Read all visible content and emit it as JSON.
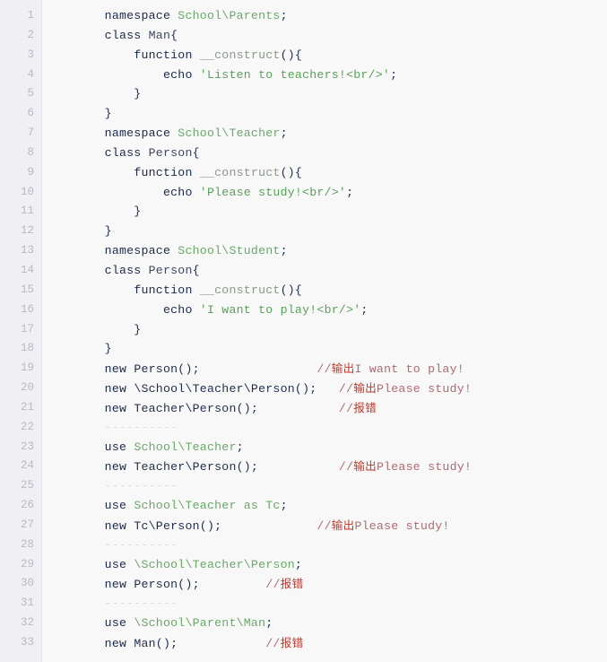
{
  "editor": {
    "language": "php",
    "total_lines": 33,
    "background": "#f8f8f8",
    "gutter_background": "#f0f0f4",
    "gutter_text_color": "#b9b9c4",
    "colors": {
      "keyword": "#1a2a4a",
      "namespace": "#6aa86a",
      "string": "#5aa05a",
      "function": "#8a998a",
      "comment": "#b06a72",
      "comment_cjk": "#c0392b",
      "separator": "#dcdcdc",
      "plain": "#1f2d4d"
    }
  },
  "line_numbers": [
    "1",
    "2",
    "3",
    "4",
    "5",
    "6",
    "7",
    "8",
    "9",
    "10",
    "11",
    "12",
    "13",
    "14",
    "15",
    "16",
    "17",
    "18",
    "19",
    "20",
    "21",
    "22",
    "23",
    "24",
    "25",
    "26",
    "27",
    "28",
    "29",
    "30",
    "31",
    "32",
    "33"
  ],
  "lines": [
    {
      "n": "1",
      "tokens": [
        {
          "t": "    ",
          "c": "plain"
        },
        {
          "t": "namespace ",
          "c": "keyword"
        },
        {
          "t": "School\\Parents",
          "c": "ns"
        },
        {
          "t": ";",
          "c": "punct"
        }
      ]
    },
    {
      "n": "2",
      "tokens": [
        {
          "t": "    ",
          "c": "plain"
        },
        {
          "t": "class ",
          "c": "keyword"
        },
        {
          "t": "Man",
          "c": "class"
        },
        {
          "t": "{",
          "c": "punct"
        }
      ]
    },
    {
      "n": "3",
      "tokens": [
        {
          "t": "        ",
          "c": "plain"
        },
        {
          "t": "function ",
          "c": "keyword"
        },
        {
          "t": "__construct",
          "c": "func"
        },
        {
          "t": "(){",
          "c": "punct"
        }
      ]
    },
    {
      "n": "4",
      "tokens": [
        {
          "t": "            ",
          "c": "plain"
        },
        {
          "t": "echo ",
          "c": "keyword"
        },
        {
          "t": "'Listen to teachers!<br/>'",
          "c": "string"
        },
        {
          "t": ";",
          "c": "punct"
        }
      ]
    },
    {
      "n": "5",
      "tokens": [
        {
          "t": "        }",
          "c": "punct"
        }
      ]
    },
    {
      "n": "6",
      "tokens": [
        {
          "t": "    }",
          "c": "punct"
        }
      ]
    },
    {
      "n": "7",
      "tokens": [
        {
          "t": "    ",
          "c": "plain"
        },
        {
          "t": "namespace ",
          "c": "keyword"
        },
        {
          "t": "School\\Teacher",
          "c": "ns"
        },
        {
          "t": ";",
          "c": "punct"
        }
      ]
    },
    {
      "n": "8",
      "tokens": [
        {
          "t": "    ",
          "c": "plain"
        },
        {
          "t": "class ",
          "c": "keyword"
        },
        {
          "t": "Person",
          "c": "class"
        },
        {
          "t": "{",
          "c": "punct"
        }
      ]
    },
    {
      "n": "9",
      "tokens": [
        {
          "t": "        ",
          "c": "plain"
        },
        {
          "t": "function ",
          "c": "keyword"
        },
        {
          "t": "__construct",
          "c": "func"
        },
        {
          "t": "(){",
          "c": "punct"
        }
      ]
    },
    {
      "n": "10",
      "tokens": [
        {
          "t": "            ",
          "c": "plain"
        },
        {
          "t": "echo ",
          "c": "keyword"
        },
        {
          "t": "'Please study!<br/>'",
          "c": "string"
        },
        {
          "t": ";",
          "c": "punct"
        }
      ]
    },
    {
      "n": "11",
      "tokens": [
        {
          "t": "        }",
          "c": "punct"
        }
      ]
    },
    {
      "n": "12",
      "tokens": [
        {
          "t": "    }",
          "c": "punct"
        }
      ]
    },
    {
      "n": "13",
      "tokens": [
        {
          "t": "    ",
          "c": "plain"
        },
        {
          "t": "namespace ",
          "c": "keyword"
        },
        {
          "t": "School\\Student",
          "c": "ns"
        },
        {
          "t": ";",
          "c": "punct"
        }
      ]
    },
    {
      "n": "14",
      "tokens": [
        {
          "t": "    ",
          "c": "plain"
        },
        {
          "t": "class ",
          "c": "keyword"
        },
        {
          "t": "Person",
          "c": "class"
        },
        {
          "t": "{",
          "c": "punct"
        }
      ]
    },
    {
      "n": "15",
      "tokens": [
        {
          "t": "        ",
          "c": "plain"
        },
        {
          "t": "function ",
          "c": "keyword"
        },
        {
          "t": "__construct",
          "c": "func"
        },
        {
          "t": "(){",
          "c": "punct"
        }
      ]
    },
    {
      "n": "16",
      "tokens": [
        {
          "t": "            ",
          "c": "plain"
        },
        {
          "t": "echo ",
          "c": "keyword"
        },
        {
          "t": "'I want to play!<br/>'",
          "c": "string"
        },
        {
          "t": ";",
          "c": "punct"
        }
      ]
    },
    {
      "n": "17",
      "tokens": [
        {
          "t": "        }",
          "c": "punct"
        }
      ]
    },
    {
      "n": "18",
      "tokens": [
        {
          "t": "    }",
          "c": "punct"
        }
      ]
    },
    {
      "n": "19",
      "tokens": [
        {
          "t": "    ",
          "c": "plain"
        },
        {
          "t": "new ",
          "c": "keyword"
        },
        {
          "t": "Person();",
          "c": "plain"
        },
        {
          "t": "                ",
          "c": "plain"
        },
        {
          "t": "//",
          "c": "comment"
        },
        {
          "t": "输出",
          "c": "cjk"
        },
        {
          "t": "I want to play!",
          "c": "comment"
        }
      ]
    },
    {
      "n": "20",
      "tokens": [
        {
          "t": "    ",
          "c": "plain"
        },
        {
          "t": "new ",
          "c": "keyword"
        },
        {
          "t": "\\School\\Teacher\\Person();",
          "c": "plain"
        },
        {
          "t": "   ",
          "c": "plain"
        },
        {
          "t": "//",
          "c": "comment"
        },
        {
          "t": "输出",
          "c": "cjk"
        },
        {
          "t": "Please study!",
          "c": "comment"
        }
      ]
    },
    {
      "n": "21",
      "tokens": [
        {
          "t": "    ",
          "c": "plain"
        },
        {
          "t": "new ",
          "c": "keyword"
        },
        {
          "t": "Teacher\\Person();",
          "c": "plain"
        },
        {
          "t": "           ",
          "c": "plain"
        },
        {
          "t": "//",
          "c": "comment"
        },
        {
          "t": "报错",
          "c": "cjk"
        }
      ]
    },
    {
      "n": "22",
      "tokens": [
        {
          "t": "    ----------",
          "c": "sep"
        }
      ]
    },
    {
      "n": "23",
      "tokens": [
        {
          "t": "    ",
          "c": "plain"
        },
        {
          "t": "use ",
          "c": "keyword"
        },
        {
          "t": "School\\Teacher",
          "c": "ns"
        },
        {
          "t": ";",
          "c": "punct"
        }
      ]
    },
    {
      "n": "24",
      "tokens": [
        {
          "t": "    ",
          "c": "plain"
        },
        {
          "t": "new ",
          "c": "keyword"
        },
        {
          "t": "Teacher\\Person();",
          "c": "plain"
        },
        {
          "t": "           ",
          "c": "plain"
        },
        {
          "t": "//",
          "c": "comment"
        },
        {
          "t": "输出",
          "c": "cjk"
        },
        {
          "t": "Please study!",
          "c": "comment"
        }
      ]
    },
    {
      "n": "25",
      "tokens": [
        {
          "t": "    ----------",
          "c": "sep"
        }
      ]
    },
    {
      "n": "26",
      "tokens": [
        {
          "t": "    ",
          "c": "plain"
        },
        {
          "t": "use ",
          "c": "keyword"
        },
        {
          "t": "School\\Teacher",
          "c": "ns"
        },
        {
          "t": " as ",
          "c": "ns"
        },
        {
          "t": "Tc",
          "c": "ns"
        },
        {
          "t": ";",
          "c": "punct"
        }
      ]
    },
    {
      "n": "27",
      "tokens": [
        {
          "t": "    ",
          "c": "plain"
        },
        {
          "t": "new ",
          "c": "keyword"
        },
        {
          "t": "Tc\\Person();",
          "c": "plain"
        },
        {
          "t": "             ",
          "c": "plain"
        },
        {
          "t": "//",
          "c": "comment"
        },
        {
          "t": "输出",
          "c": "cjk"
        },
        {
          "t": "Please study!",
          "c": "comment"
        }
      ]
    },
    {
      "n": "28",
      "tokens": [
        {
          "t": "    ----------",
          "c": "sep"
        }
      ]
    },
    {
      "n": "29",
      "tokens": [
        {
          "t": "    ",
          "c": "plain"
        },
        {
          "t": "use ",
          "c": "keyword"
        },
        {
          "t": "\\School\\Teacher\\Person",
          "c": "ns"
        },
        {
          "t": ";",
          "c": "punct"
        }
      ]
    },
    {
      "n": "30",
      "tokens": [
        {
          "t": "    ",
          "c": "plain"
        },
        {
          "t": "new ",
          "c": "keyword"
        },
        {
          "t": "Person();",
          "c": "plain"
        },
        {
          "t": "         ",
          "c": "plain"
        },
        {
          "t": "//",
          "c": "comment"
        },
        {
          "t": "报错",
          "c": "cjk"
        }
      ]
    },
    {
      "n": "31",
      "tokens": [
        {
          "t": "    ----------",
          "c": "sep"
        }
      ]
    },
    {
      "n": "32",
      "tokens": [
        {
          "t": "    ",
          "c": "plain"
        },
        {
          "t": "use ",
          "c": "keyword"
        },
        {
          "t": "\\School\\Parent\\Man",
          "c": "ns"
        },
        {
          "t": ";",
          "c": "punct"
        }
      ]
    },
    {
      "n": "33",
      "tokens": [
        {
          "t": "    ",
          "c": "plain"
        },
        {
          "t": "new ",
          "c": "keyword"
        },
        {
          "t": "Man();",
          "c": "plain"
        },
        {
          "t": "            ",
          "c": "plain"
        },
        {
          "t": "//",
          "c": "comment"
        },
        {
          "t": "报错",
          "c": "cjk"
        }
      ]
    }
  ]
}
